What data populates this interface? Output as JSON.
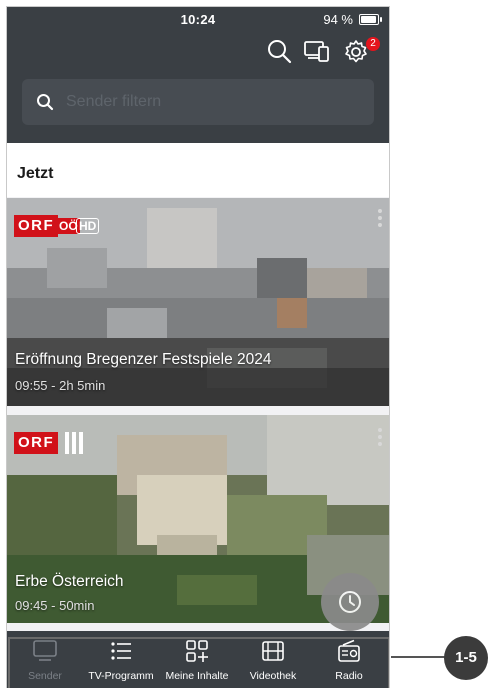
{
  "status_bar": {
    "time": "10:24",
    "battery": "94 %"
  },
  "header": {
    "notification_count": "2"
  },
  "search": {
    "placeholder": "Sender filtern"
  },
  "section": {
    "title": "Jetzt"
  },
  "cards": [
    {
      "channel": "ORF",
      "channel_tag": "OÖ",
      "hd": "HD",
      "title": "Eröffnung Bregenzer Festspiele 2024",
      "meta": "09:55 - 2h 5min"
    },
    {
      "channel": "ORF",
      "channel_tag": "III",
      "title": "Erbe Österreich",
      "meta": "09:45 - 50min"
    }
  ],
  "tabs": [
    {
      "label": "Sender",
      "icon": "tv-icon",
      "active": true
    },
    {
      "label": "TV-Programm",
      "icon": "list-icon"
    },
    {
      "label": "Meine Inhalte",
      "icon": "grid-plus-icon"
    },
    {
      "label": "Videothek",
      "icon": "film-icon"
    },
    {
      "label": "Radio",
      "icon": "radio-icon"
    }
  ],
  "callout": "1-5",
  "colors": {
    "header": "#3a3f44",
    "orf_red": "#d11119",
    "badge": "#e4141c"
  }
}
